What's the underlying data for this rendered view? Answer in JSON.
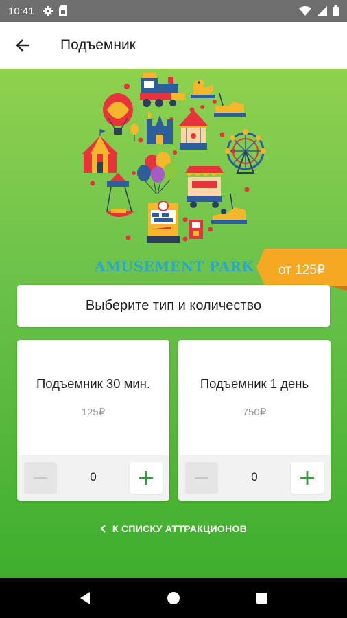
{
  "status_bar": {
    "time": "10:41",
    "icons": [
      "gear-icon",
      "sim-icon",
      "wifi-icon",
      "signal-icon",
      "battery-icon"
    ]
  },
  "app_bar": {
    "title": "Подъемник",
    "back_icon": "arrow-left-icon"
  },
  "hero": {
    "brand_text": "AMUSEMENT PARK",
    "brand_color": "#2aa8c4"
  },
  "price_ribbon": {
    "label": "от 125₽",
    "color": "#f7a823"
  },
  "choose_card": {
    "label": "Выберите тип и количество"
  },
  "tickets": [
    {
      "name": "Подъемник 30 мин.",
      "price": "125₽",
      "quantity": "0"
    },
    {
      "name": "Подъемник 1 день",
      "price": "750₽",
      "quantity": "0"
    }
  ],
  "back_link": {
    "label": "К СПИСКУ АТТРАКЦИОНОВ",
    "icon": "chevron-left-icon"
  },
  "colors": {
    "accent_green": "#2e9e3a",
    "background_top": "#8fd14f",
    "background_bottom": "#3fae2c"
  },
  "nav_bar": {
    "icons": [
      "nav-back-icon",
      "nav-home-icon",
      "nav-recents-icon"
    ]
  }
}
